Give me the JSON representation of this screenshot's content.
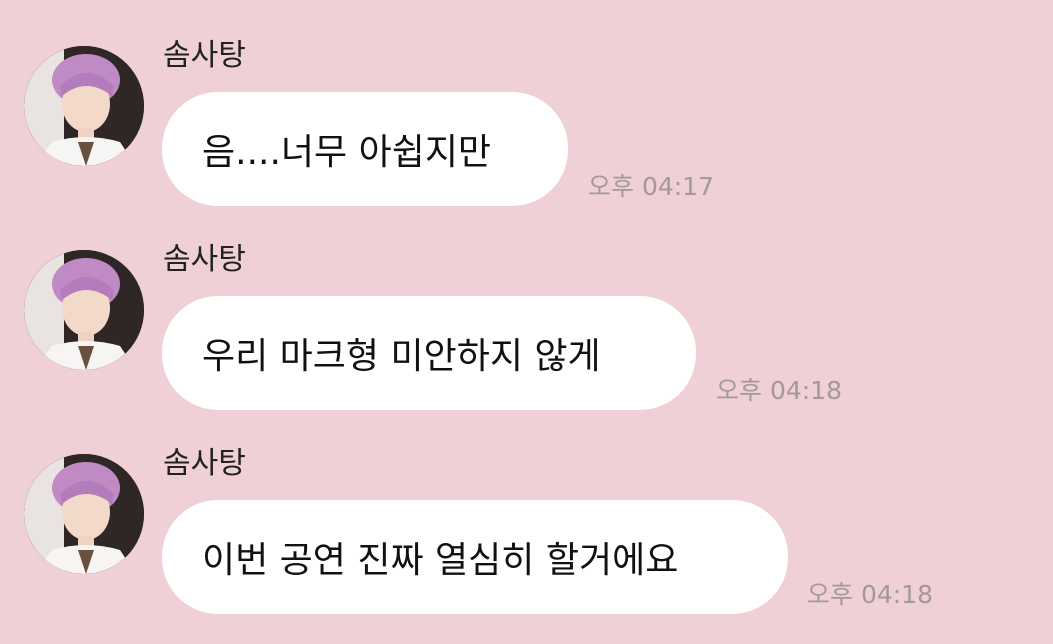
{
  "chat": {
    "messages": [
      {
        "sender": "솜사탕",
        "text": "음....너무 아쉽지만",
        "time": "오후 04:17"
      },
      {
        "sender": "솜사탕",
        "text": "우리 마크형 미안하지 않게",
        "time": "오후 04:18"
      },
      {
        "sender": "솜사탕",
        "text": "이번 공연 진짜 열심히 할거에요",
        "time": "오후 04:18"
      }
    ]
  },
  "colors": {
    "background": "#f0d0d7",
    "bubble": "#ffffff",
    "timestamp": "#a3989b"
  },
  "icons": {
    "avatar": "profile-photo"
  }
}
